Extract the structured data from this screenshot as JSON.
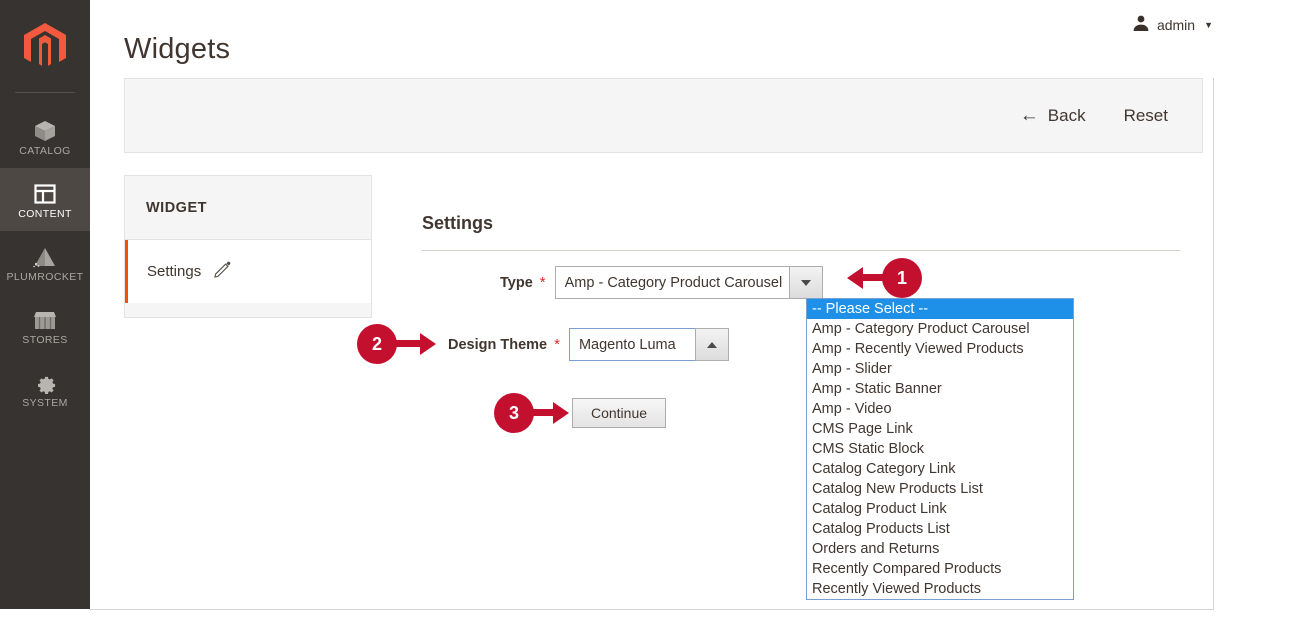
{
  "sidebar": {
    "logo_icon": "magento-logo-icon",
    "items": [
      {
        "label": "CATALOG",
        "icon": "box-icon",
        "active": false
      },
      {
        "label": "CONTENT",
        "icon": "layout-icon",
        "active": true
      },
      {
        "label": "PLUMROCKET",
        "icon": "mountain-icon",
        "active": false
      },
      {
        "label": "STORES",
        "icon": "storefront-icon",
        "active": false
      },
      {
        "label": "SYSTEM",
        "icon": "gear-icon",
        "active": false
      }
    ]
  },
  "header": {
    "title": "Widgets",
    "account_name": "admin",
    "account_icon": "user-icon",
    "account_caret": "▼"
  },
  "page_actions": {
    "back_label": "Back",
    "back_icon": "←",
    "reset_label": "Reset"
  },
  "widget_panel": {
    "title": "WIDGET",
    "nav_items": [
      {
        "label": "Settings",
        "icon": "pencil-icon",
        "active": true
      }
    ]
  },
  "settings": {
    "title": "Settings",
    "required_marker": "*",
    "type_field": {
      "label": "Type",
      "value": "Amp - Category Product Carousel",
      "arrow_icon": "chevron-down-icon"
    },
    "design_theme_field": {
      "label": "Design Theme",
      "value": "Magento Luma",
      "arrow_icon": "chevron-up-icon"
    },
    "continue_label": "Continue"
  },
  "type_dropdown": {
    "options": [
      "-- Please Select --",
      "Amp - Category Product Carousel",
      "Amp - Recently Viewed Products",
      "Amp - Slider",
      "Amp - Static Banner",
      "Amp - Video",
      "CMS Page Link",
      "CMS Static Block",
      "Catalog Category Link",
      "Catalog New Products List",
      "Catalog Product Link",
      "Catalog Products List",
      "Orders and Returns",
      "Recently Compared Products",
      "Recently Viewed Products"
    ],
    "selected_index": 0
  },
  "annotations": [
    {
      "number": "1",
      "direction": "left"
    },
    {
      "number": "2",
      "direction": "right"
    },
    {
      "number": "3",
      "direction": "right"
    }
  ],
  "colors": {
    "brand_orange": "#eb5202",
    "sidebar_bg": "#373330",
    "sidebar_active_bg": "#4e4844",
    "annotation_red": "#c3102f",
    "dropdown_highlight": "#1e90e8",
    "required_red": "#e02b27"
  }
}
